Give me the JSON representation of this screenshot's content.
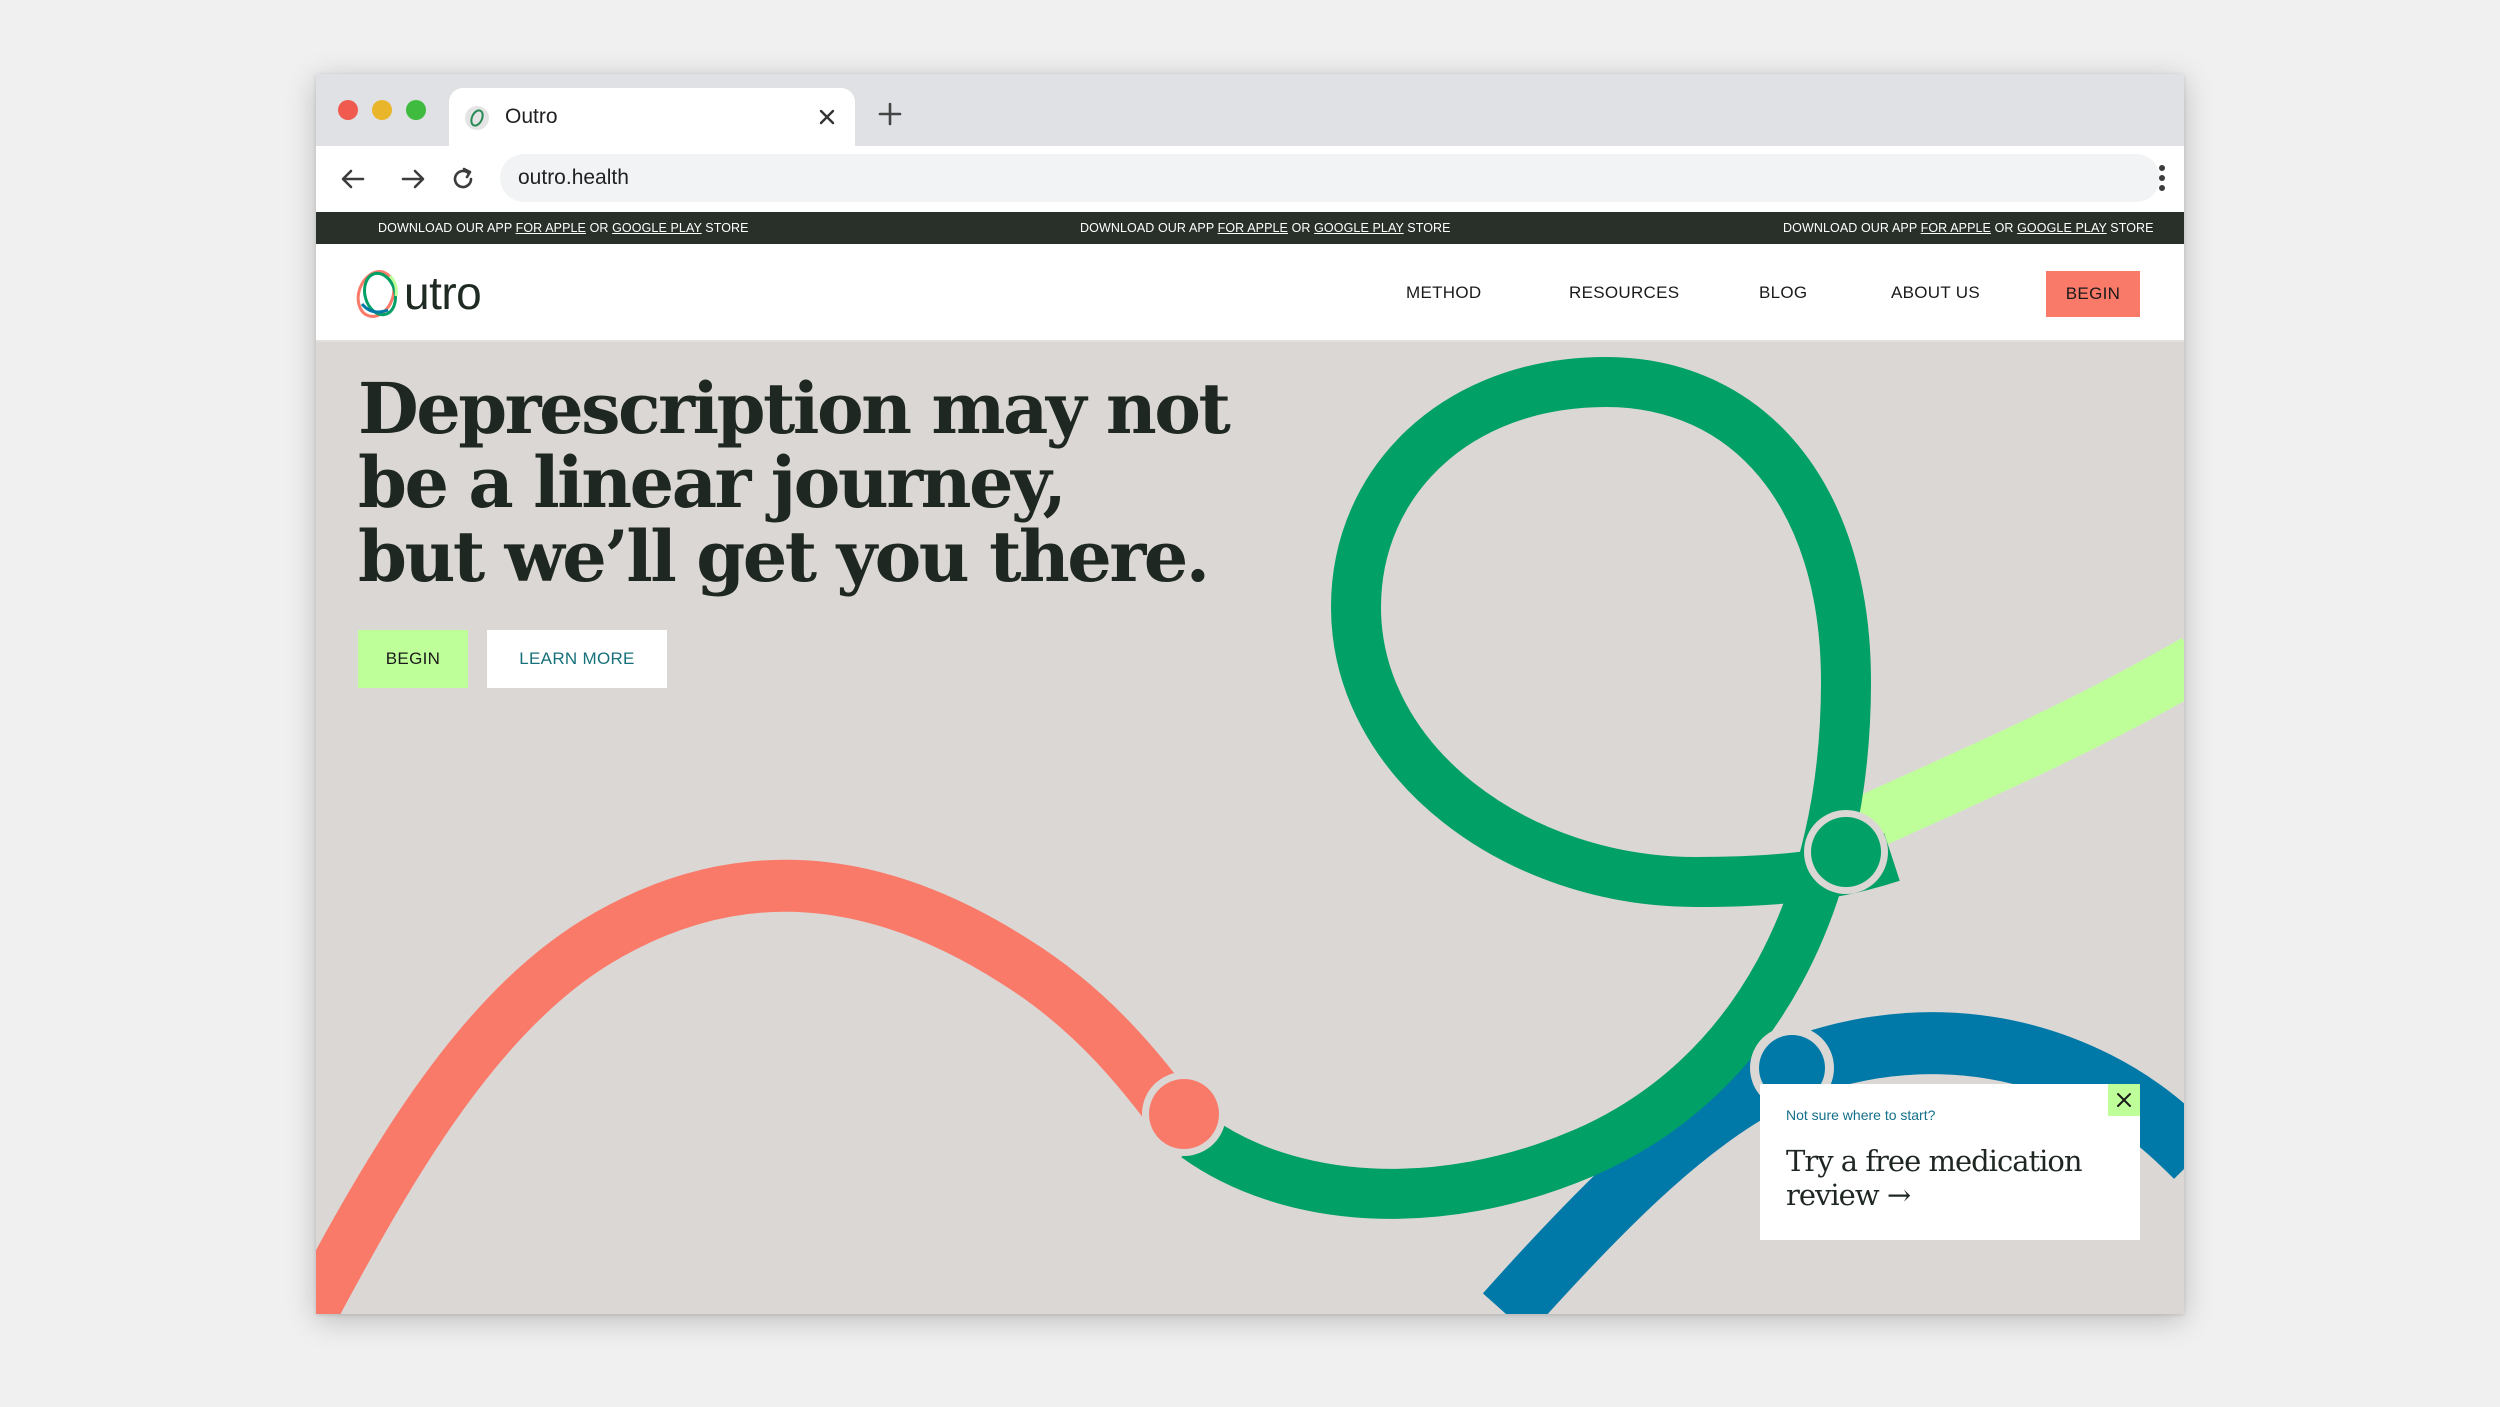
{
  "browser": {
    "tab_title": "Outro",
    "url": "outro.health"
  },
  "announcement": {
    "prefix": "DOWNLOAD OUR APP",
    "apple": "FOR APPLE",
    "or": "OR",
    "google": "GOOGLE PLAY",
    "suffix": "STORE"
  },
  "header": {
    "logo_text": "utro",
    "nav": {
      "method": "METHOD",
      "resources": "RESOURCES",
      "blog": "BLOG",
      "about": "ABOUT US",
      "begin": "BEGIN"
    }
  },
  "hero": {
    "title_lines": [
      "Deprescription may not",
      "be a linear journey,",
      "but we’ll get you there."
    ],
    "begin_label": "BEGIN",
    "learn_more_label": "LEARN MORE"
  },
  "promo": {
    "eyebrow": "Not sure where to start?",
    "body": "Try a free medication review →"
  },
  "colors": {
    "announcement_bg": "#283029",
    "hero_bg": "#dbd7d4",
    "accent_coral": "#fa7a6a",
    "accent_green": "#00a066",
    "accent_lime": "#bfff9a",
    "accent_blue": "#0079a8"
  },
  "icons": [
    "favicon-icon",
    "close-icon",
    "plus-icon",
    "back-arrow-icon",
    "forward-arrow-icon",
    "reload-icon",
    "kebab-menu-icon",
    "close-icon"
  ]
}
